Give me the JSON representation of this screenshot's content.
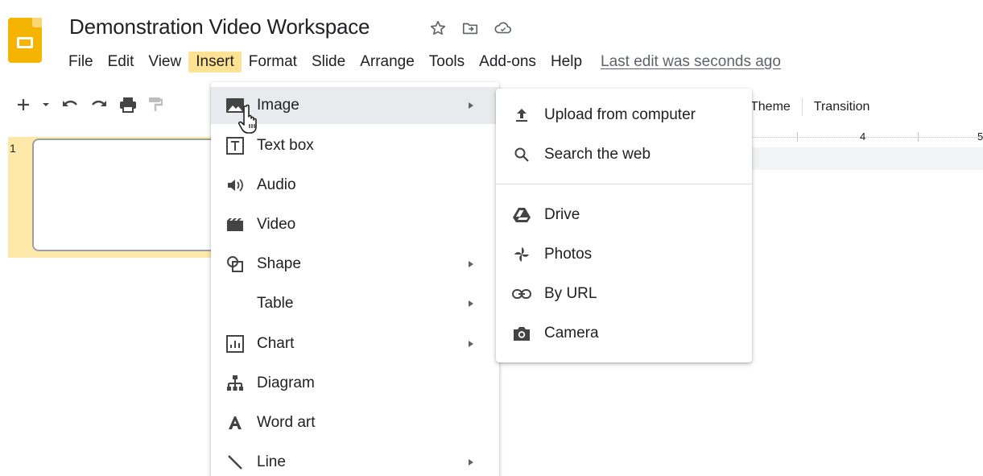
{
  "document": {
    "title": "Demonstration Video Workspace"
  },
  "menubar": {
    "items": [
      "File",
      "Edit",
      "View",
      "Insert",
      "Format",
      "Slide",
      "Arrange",
      "Tools",
      "Add-ons",
      "Help"
    ],
    "active": "Insert",
    "last_edit": "Last edit was seconds ago"
  },
  "toolbar": {
    "theme_label": "Theme",
    "transition_label": "Transition"
  },
  "ruler": {
    "mark_4": "4",
    "mark_5": "5"
  },
  "filmstrip": {
    "slide_number": "1"
  },
  "insert_menu": {
    "items": [
      {
        "label": "Image",
        "icon": "image-icon",
        "submenu": true
      },
      {
        "label": "Text box",
        "icon": "text-box-icon",
        "submenu": false
      },
      {
        "label": "Audio",
        "icon": "audio-icon",
        "submenu": false
      },
      {
        "label": "Video",
        "icon": "video-icon",
        "submenu": false
      },
      {
        "label": "Shape",
        "icon": "shape-icon",
        "submenu": true
      },
      {
        "label": "Table",
        "icon": "",
        "submenu": true
      },
      {
        "label": "Chart",
        "icon": "chart-icon",
        "submenu": true
      },
      {
        "label": "Diagram",
        "icon": "diagram-icon",
        "submenu": false
      },
      {
        "label": "Word art",
        "icon": "word-art-icon",
        "submenu": false
      },
      {
        "label": "Line",
        "icon": "line-icon",
        "submenu": true
      }
    ]
  },
  "image_submenu": {
    "items": [
      {
        "label": "Upload from computer",
        "icon": "upload-icon"
      },
      {
        "label": "Search the web",
        "icon": "search-icon"
      },
      {
        "label": "Drive",
        "icon": "drive-icon"
      },
      {
        "label": "Photos",
        "icon": "photos-icon"
      },
      {
        "label": "By URL",
        "icon": "link-icon"
      },
      {
        "label": "Camera",
        "icon": "camera-icon"
      }
    ]
  },
  "colors": {
    "logo": "#f4b400",
    "menu_active": "#fde293",
    "filmstrip_selected": "#fde8a9",
    "hover": "#e8eaed"
  }
}
